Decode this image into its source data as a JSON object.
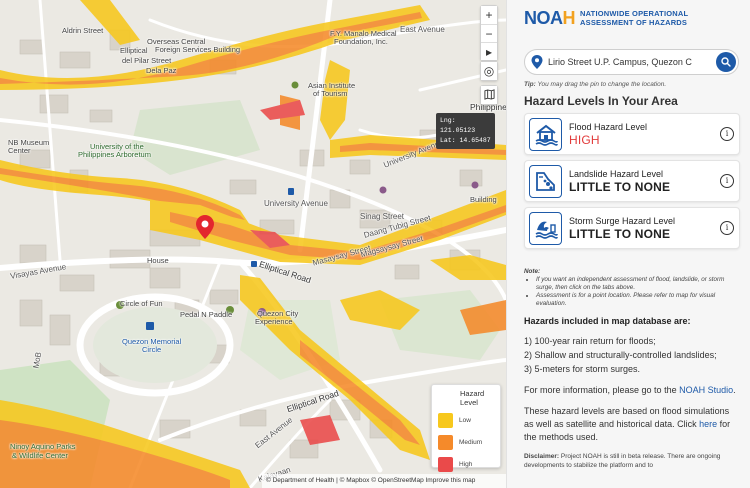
{
  "map": {
    "labels": {
      "aldrin": "Aldrin Street",
      "overseas": "Overseas Central",
      "foreign_bldg": "Foreign Services Building",
      "elliptical": "Elliptical",
      "del_pilar": "del Pilar Street",
      "dela_paz": "Dela Paz",
      "fy_manalo": "F.Y. Manalo Medical",
      "foundation": "Foundation, Inc.",
      "east_avenue_top": "East Avenue",
      "asian_institute": "Asian Institute",
      "of_tourism": "of Tourism",
      "philippine": "Philippine",
      "nb_museum": "NB Museum",
      "nb_center": "Center",
      "arboretum_1": "University of the",
      "arboretum_2": "Philippines Arboretum",
      "university_ave_mid": "University Avenue",
      "university_ave_right": "University Avenue",
      "visayas": "Visayas Avenue",
      "elliptical_road_mid": "Elliptical Road",
      "magsaysay_street": "Masaysay Street",
      "magsaysay_street_2": "Magsaysay Street",
      "sinag": "Sinag Street",
      "daang_tubig": "Daang Tubig Street",
      "bldg": "Building",
      "house": "House",
      "circle_of_fun": "Circle of Fun",
      "pedal_n_paddle": "Pedal N Paddle",
      "quezon_city_1": "Quezon City",
      "quezon_city_2": "Experience",
      "quezon_memorial_1": "Quezon Memorial",
      "quezon_memorial_2": "Circle",
      "mob": "MoB",
      "elliptical_road_low": "Elliptical Road",
      "east_avenue_low": "East Avenue",
      "ninoy_1": "Ninoy Aquino Parks",
      "ninoy_2": "& Wildlife Center",
      "kalayaan": "Kalayaan"
    },
    "coords": {
      "lng": "Lng: 121.05123",
      "lat": "Lat: 14.65487"
    },
    "controls": {
      "zoom_in": "+",
      "zoom_out": "−",
      "compass": "▸",
      "locate": "◎",
      "layers": "▭"
    },
    "legend": {
      "title": "Hazard Level",
      "items": [
        {
          "label": "Low",
          "color": "#f7c81d"
        },
        {
          "label": "Medium",
          "color": "#f58a2a"
        },
        {
          "label": "High",
          "color": "#ea4a4a"
        }
      ]
    },
    "attribution": "© Department of Health | © Mapbox © OpenStreetMap Improve this map"
  },
  "panel": {
    "brand_logo_main": "NOA",
    "brand_logo_accent": "H",
    "brand_line1": "NATIONWIDE OPERATIONAL",
    "brand_line2": "ASSESSMENT OF HAZARDS",
    "search": {
      "value": "Lirio Street U.P. Campus, Quezon C"
    },
    "tip_label": "Tip:",
    "tip_text": "You may drag the pin to change the location.",
    "heading": "Hazard Levels In Your Area",
    "cards": [
      {
        "title": "Flood Hazard Level",
        "value": "HIGH",
        "icon": "flood-house-icon"
      },
      {
        "title": "Landslide Hazard Level",
        "value": "LITTLE TO NONE",
        "icon": "landslide-icon"
      },
      {
        "title": "Storm Surge Hazard Level",
        "value": "LITTLE TO NONE",
        "icon": "storm-surge-wave-icon"
      }
    ],
    "note_title": "Note:",
    "note_items": [
      "If you want an independent assessment of flood, landslide, or storm surge, then click on the tabs above.",
      "Assessment is for a point location. Please refer to map for visual evaluation."
    ],
    "db_title": "Hazards included in map database are:",
    "db_items": [
      "1) 100-year rain return for floods;",
      "2) Shallow and structurally-controlled landslides;",
      "3) 5-meters for storm surges."
    ],
    "more_info_pre": "For more information, please go to the ",
    "more_info_link": "NOAH Studio",
    "more_info_post": ".",
    "basis_pre": "These hazard levels are based on flood simulations as well as satellite and historical data. Click ",
    "basis_link": "here",
    "basis_post": " for the methods used.",
    "disclaimer_label": "Disclaimer:",
    "disclaimer_text": " Project NOAH is still in beta release. There are ongoing developments to stabilize the platform and to"
  }
}
